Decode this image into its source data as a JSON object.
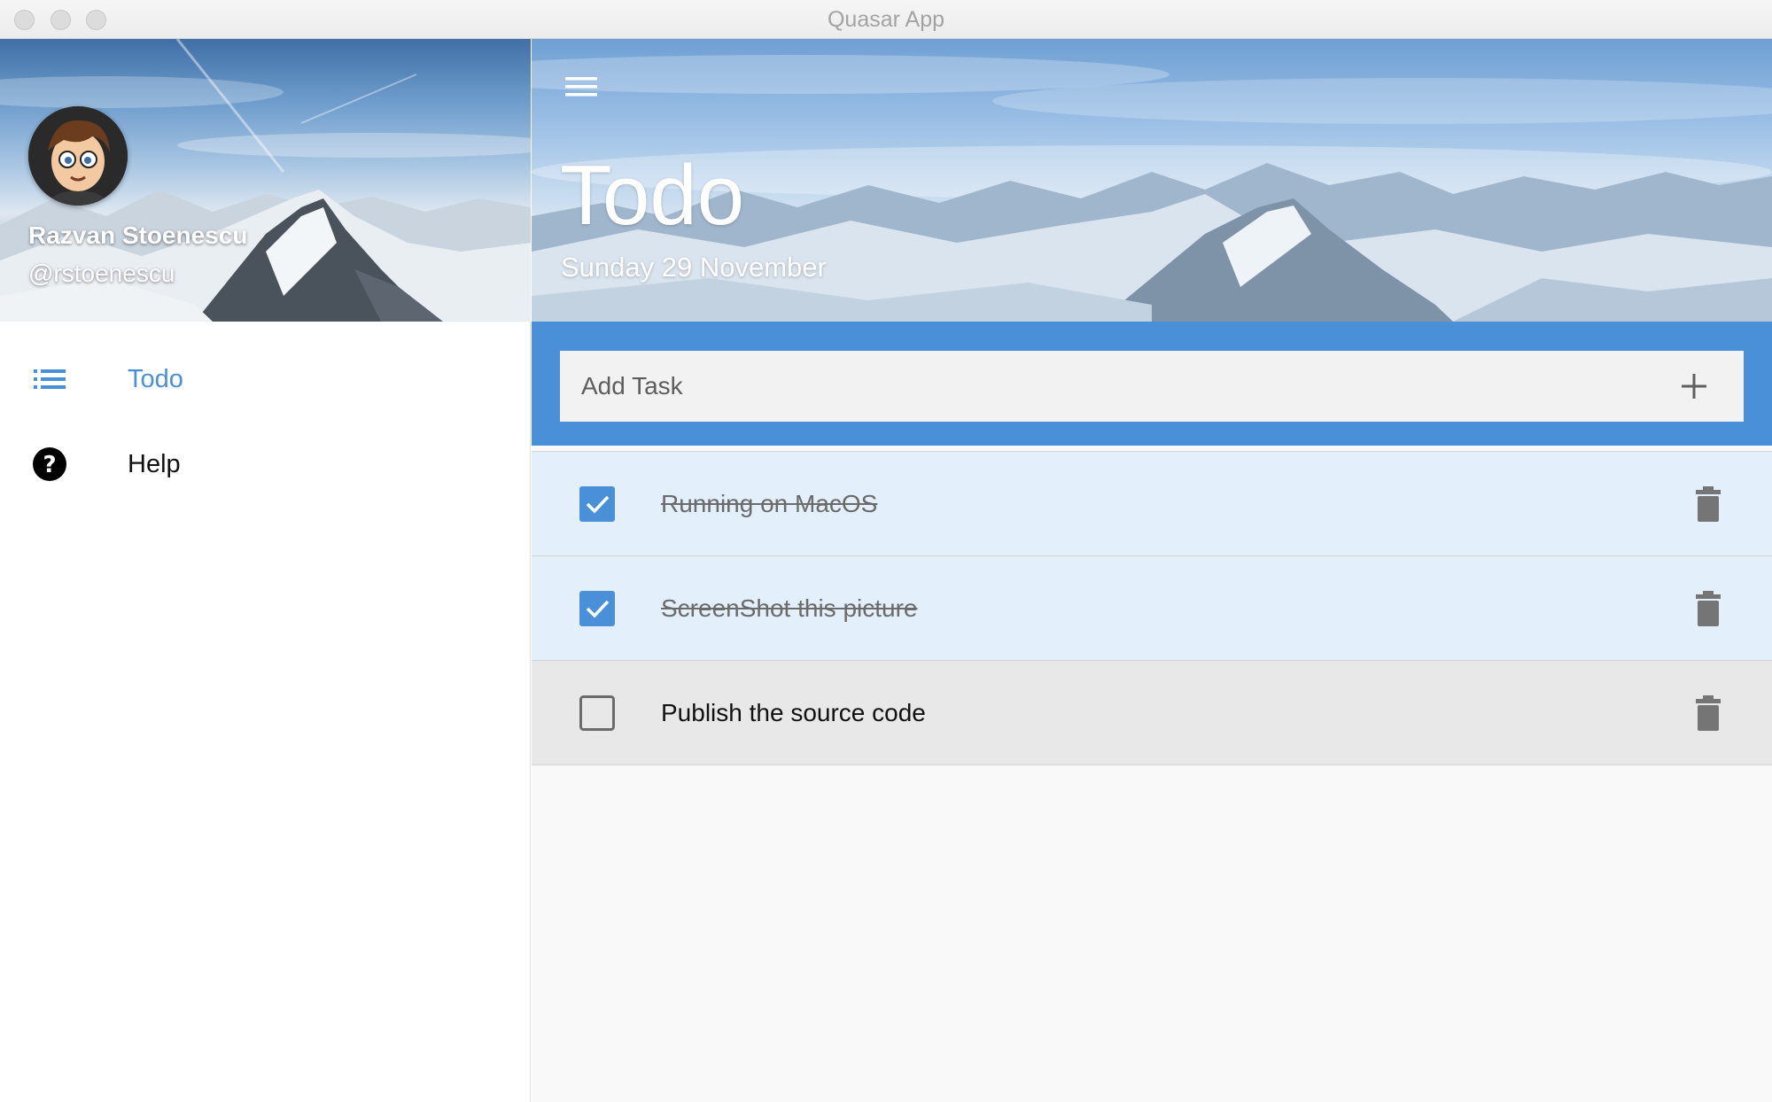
{
  "window": {
    "title": "Quasar App"
  },
  "sidebar": {
    "user": {
      "name": "Razvan Stoenescu",
      "handle": "@rstoenescu"
    },
    "items": [
      {
        "label": "Todo",
        "icon": "list-icon",
        "active": true
      },
      {
        "label": "Help",
        "icon": "help-icon",
        "active": false
      }
    ]
  },
  "header": {
    "title": "Todo",
    "date": "Sunday 29 November"
  },
  "add_task": {
    "placeholder": "Add Task",
    "value": ""
  },
  "tasks": [
    {
      "text": "Running on MacOS",
      "done": true
    },
    {
      "text": "ScreenShot this picture",
      "done": true
    },
    {
      "text": "Publish the source code",
      "done": false
    }
  ],
  "colors": {
    "accent": "#4a90d9",
    "done_row": "#e3f0fc",
    "pending_row": "#e8e8e8",
    "icon_grey": "#757575"
  }
}
